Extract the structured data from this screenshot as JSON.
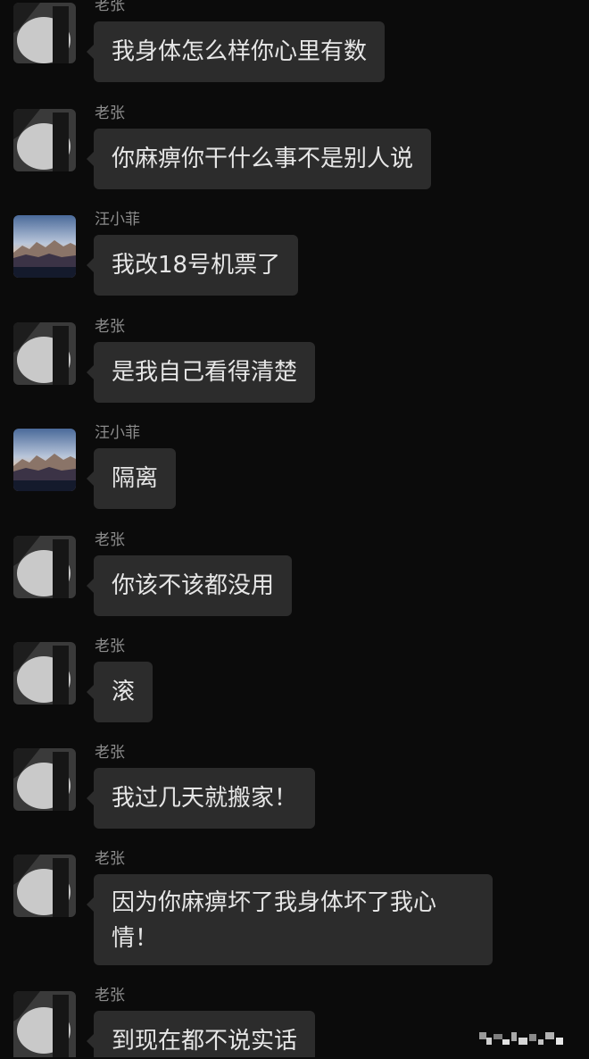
{
  "senders": {
    "lao_zhang": "老张",
    "wang_xiaofei": "汪小菲"
  },
  "messages": [
    {
      "sender": "老张",
      "text": "我身体怎么样你心里有数"
    },
    {
      "sender": "老张",
      "text": "你麻痹你干什么事不是别人说"
    },
    {
      "sender": "汪小菲",
      "text": "我改18号机票了"
    },
    {
      "sender": "老张",
      "text": "是我自己看得清楚"
    },
    {
      "sender": "汪小菲",
      "text": "隔离"
    },
    {
      "sender": "老张",
      "text": "你该不该都没用"
    },
    {
      "sender": "老张",
      "text": "滚"
    },
    {
      "sender": "老张",
      "text": "我过几天就搬家！"
    },
    {
      "sender": "老张",
      "text": "因为你麻痹坏了我身体坏了我心情！"
    },
    {
      "sender": "老张",
      "text": "到现在都不说实话"
    }
  ],
  "avatars": {
    "lao_zhang": "dark-silhouette-avatar",
    "wang_xiaofei": "mountain-landscape-avatar"
  },
  "colors": {
    "background": "#0b0b0b",
    "bubble": "#2c2c2c",
    "bubble_text": "#e6e6e6",
    "sender_name": "#8c8c8c"
  }
}
